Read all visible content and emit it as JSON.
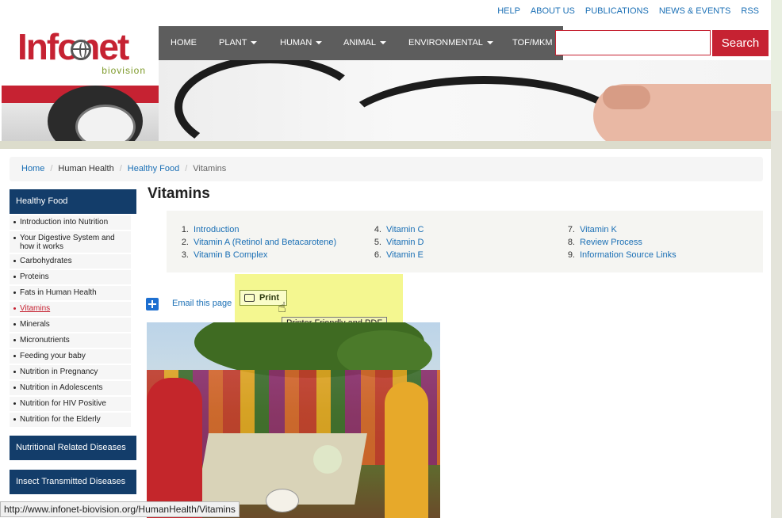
{
  "top_links": [
    "HELP",
    "ABOUT US",
    "PUBLICATIONS",
    "NEWS & EVENTS",
    "RSS"
  ],
  "logo": {
    "wordmark": "Infonet",
    "sub": "biovision"
  },
  "nav": [
    {
      "label": "HOME",
      "dropdown": false
    },
    {
      "label": "PLANT",
      "dropdown": true
    },
    {
      "label": "HUMAN",
      "dropdown": true
    },
    {
      "label": "ANIMAL",
      "dropdown": true
    },
    {
      "label": "ENVIRONMENTAL",
      "dropdown": true
    },
    {
      "label": "TOF/MKM",
      "dropdown": false
    }
  ],
  "search": {
    "placeholder": "",
    "button_label": "Search"
  },
  "breadcrumb": {
    "home": "Home",
    "level1": "Human Health",
    "level2": "Healthy Food",
    "current": "Vitamins"
  },
  "sidebar": {
    "heading": "Healthy Food",
    "items": [
      "Introduction into Nutrition",
      "Your Digestive System and how it works",
      "Carbohydrates",
      "Proteins",
      "Fats in Human Health",
      "Vitamins",
      "Minerals",
      "Micronutrients",
      "Feeding your baby",
      "Nutrition in Pregnancy",
      "Nutrition in Adolescents",
      "Nutrition for HIV Positive",
      "Nutrition for the Elderly"
    ],
    "active_index": 5,
    "boxes": [
      "Nutritional Related Diseases",
      "Insect Transmitted Diseases"
    ]
  },
  "main": {
    "title": "Vitamins",
    "toc": [
      {
        "num": "1.",
        "label": "Introduction"
      },
      {
        "num": "2.",
        "label": "Vitamin A (Retinol and Betacarotene)"
      },
      {
        "num": "3.",
        "label": "Vitamin B Complex"
      },
      {
        "num": "4.",
        "label": "Vitamin C"
      },
      {
        "num": "5.",
        "label": "Vitamin D"
      },
      {
        "num": "6.",
        "label": "Vitamin E"
      },
      {
        "num": "7.",
        "label": "Vitamin K"
      },
      {
        "num": "8.",
        "label": "Review Process"
      },
      {
        "num": "9.",
        "label": "Information Source Links"
      }
    ],
    "email_label": "Email this page",
    "print_label": "Print",
    "tooltip": "Printer Friendly and PDF"
  },
  "status_url": "http://www.infonet-biovision.org/HumanHealth/Vitamins",
  "colors": {
    "brand_red": "#c62232",
    "nav_gray": "#5d5d5d",
    "sidebar_blue": "#133d6a",
    "link_blue": "#1a6fb5",
    "highlight": "#f3f78a"
  }
}
